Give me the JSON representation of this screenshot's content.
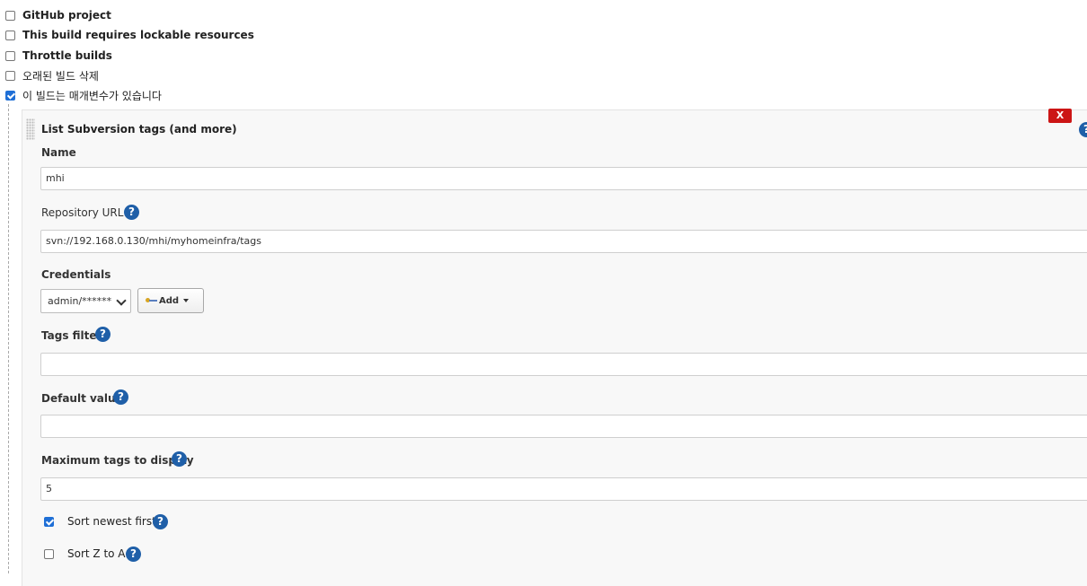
{
  "options": [
    {
      "label": "GitHub project",
      "checked": false
    },
    {
      "label": "This build requires lockable resources",
      "checked": false
    },
    {
      "label": "Throttle builds",
      "checked": false
    },
    {
      "label": "오래된 빌드 삭제",
      "checked": false
    },
    {
      "label": "이 빌드는 매개변수가 있습니다",
      "checked": true
    }
  ],
  "parameter": {
    "title": "List Subversion tags (and more)",
    "delete_label": "X",
    "help_glyph": "?",
    "name": {
      "label": "Name",
      "value": "mhi"
    },
    "repository_url": {
      "label": "Repository URL",
      "value": "svn://192.168.0.130/mhi/myhomeinfra/tags"
    },
    "credentials": {
      "label": "Credentials",
      "selected": "admin/******",
      "add_label": "Add"
    },
    "tags_filter": {
      "label": "Tags filter",
      "value": ""
    },
    "default_value": {
      "label": "Default value",
      "value": ""
    },
    "max_tags": {
      "label": "Maximum tags to display",
      "value": "5"
    },
    "sort_newest": {
      "label": "Sort newest first",
      "checked": true
    },
    "sort_z_to_a": {
      "label": "Sort Z to A",
      "checked": false
    }
  },
  "colors": {
    "accent": "#1f6fd6",
    "help": "#1f5fa8",
    "delete": "#cc1515"
  }
}
